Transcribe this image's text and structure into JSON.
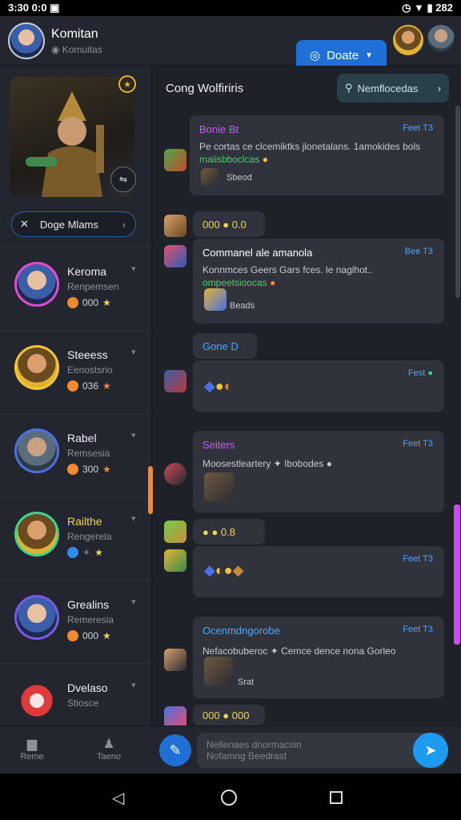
{
  "status": {
    "time": "3:30",
    "extra": "0:0",
    "battery": "282"
  },
  "header": {
    "title": "Komitan",
    "subtitle": "Komuitas",
    "donate_label": "Doate"
  },
  "sidebar": {
    "filter_label": "Doge Mlams",
    "items": [
      {
        "name": "Keroma",
        "sub": "Renpemsen",
        "count": "000",
        "ring": "#e44bd0"
      },
      {
        "name": "Steeess",
        "sub": "Eenostsrio",
        "count": "036",
        "ring": "#f3c43a"
      },
      {
        "name": "Rabel",
        "sub": "Remsesia",
        "count": "300",
        "ring": "#4b6fe6"
      },
      {
        "name": "Railthe",
        "sub": "Rengerela",
        "count": "",
        "ring": "#3ad68c"
      },
      {
        "name": "Grealins",
        "sub": "Remeresia",
        "count": "000",
        "ring": "#7a59e6"
      },
      {
        "name": "Dvelaso",
        "sub": "Stiosce",
        "count": "",
        "ring": "#e03a3a"
      }
    ]
  },
  "main": {
    "title": "Cong Wolfiriris",
    "search_label": "Nemflocedas",
    "msg1": {
      "title": "Bonie Bt",
      "tag": "Feet T3",
      "text": "Pe cortas ce clcemiktks jlonetalans. 1amokides bols",
      "link": "maiisbboclcas",
      "reply": "Sbeod"
    },
    "chip1": "000 ● 0.0",
    "msg2": {
      "title": "Commanel ale amanola",
      "tag": "Bee T3",
      "text": "Konnmces Geers Gars fces. le naglhot..",
      "link": "ompeetsioocas",
      "reply": "Beads"
    },
    "chip2": "Gone  D",
    "msg3": {
      "tag": "Fest"
    },
    "msg4": {
      "title": "Seiters",
      "tag": "Feet T3",
      "text": "Moosestleartery ✦ Ibobodes ●"
    },
    "chip3": "● ● 0.8",
    "msg5": {
      "tag": "Feet T3"
    },
    "msg6": {
      "title": "Ocenmdngorobe",
      "tag": "Feet T3",
      "text": "Nefacobuberoc ✦ Cemce dence nona Gorleo",
      "reply": "Srat"
    },
    "chip4": "000 ● 000",
    "input_line1": "Nellenaes dnormacsin",
    "input_line2": "Nofamng Beedrast"
  },
  "bottom": {
    "home_label": "Reme",
    "team_label": "Taeno"
  },
  "colors": {
    "accent": "#1f6fd6",
    "purple": "#c05cff",
    "blue_title": "#4aa8ff",
    "orange": "#f28b2f"
  }
}
